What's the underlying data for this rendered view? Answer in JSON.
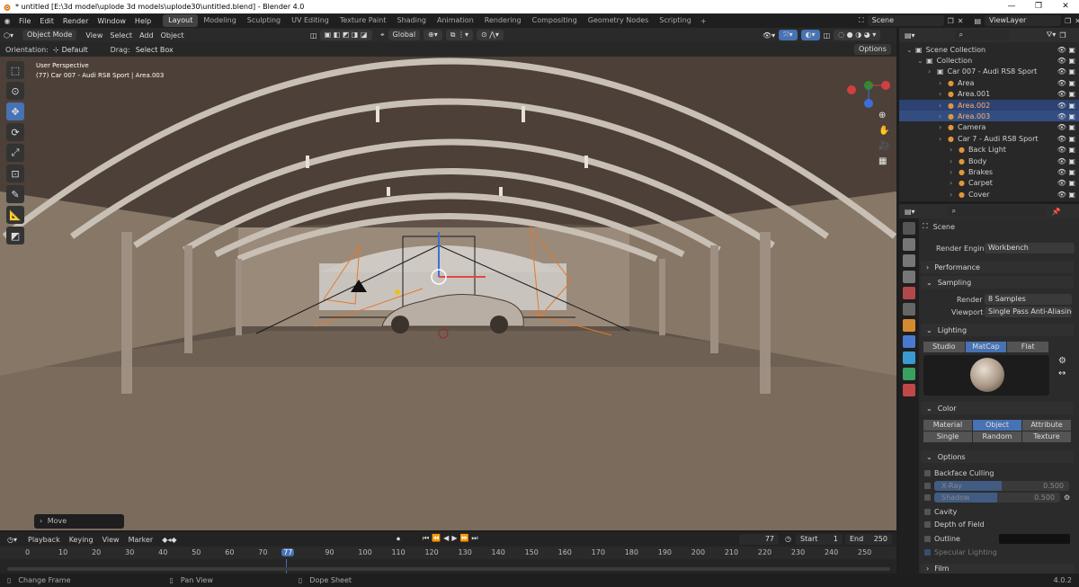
{
  "window": {
    "title": "* untitled [E:\\3d model\\uplode 3d models\\uplode30\\untitled.blend] - Blender 4.0"
  },
  "menus": [
    "File",
    "Edit",
    "Render",
    "Window",
    "Help"
  ],
  "workspaces": [
    "Layout",
    "Modeling",
    "Sculpting",
    "UV Editing",
    "Texture Paint",
    "Shading",
    "Animation",
    "Rendering",
    "Compositing",
    "Geometry Nodes",
    "Scripting"
  ],
  "scene_field": "Scene",
  "viewlayer_field": "ViewLayer",
  "viewport_header": {
    "mode": "Object Mode",
    "menus": [
      "View",
      "Select",
      "Add",
      "Object"
    ],
    "transform": "Global",
    "options": "Options"
  },
  "tool_header": {
    "orientation_label": "Orientation:",
    "orientation_value": "Default",
    "drag_label": "Drag:",
    "drag_value": "Select Box"
  },
  "viewport": {
    "perspective": "User Perspective",
    "object_info": "(77) Car 007 - Audi RS8 Sport | Area.003",
    "last_op": "Move"
  },
  "timeline": {
    "menus": [
      "Playback",
      "Keying",
      "View",
      "Marker"
    ],
    "current_frame": "77",
    "start_label": "Start",
    "start": "1",
    "end_label": "End",
    "end": "250",
    "ticks": [
      "0",
      "10",
      "20",
      "30",
      "40",
      "50",
      "60",
      "70",
      "77",
      "90",
      "100",
      "110",
      "120",
      "130",
      "140",
      "150",
      "160",
      "170",
      "180",
      "190",
      "200",
      "210",
      "220",
      "230",
      "240",
      "250"
    ]
  },
  "statusbar": {
    "items": [
      "Change Frame",
      "Pan View",
      "Dope Sheet"
    ],
    "version": "4.0.2"
  },
  "outliner": {
    "rows": [
      {
        "label": "Scene Collection",
        "indent": 0,
        "sel": ""
      },
      {
        "label": "Collection",
        "indent": 1,
        "sel": ""
      },
      {
        "label": "Car 007 - Audi RS8 Sport",
        "indent": 2,
        "sel": ""
      },
      {
        "label": "Area",
        "indent": 3,
        "sel": ""
      },
      {
        "label": "Area.001",
        "indent": 3,
        "sel": ""
      },
      {
        "label": "Area.002",
        "indent": 3,
        "sel": "sel2"
      },
      {
        "label": "Area.003",
        "indent": 3,
        "sel": "sel"
      },
      {
        "label": "Camera",
        "indent": 3,
        "sel": ""
      },
      {
        "label": "Car 7 - Audi RS8 Sport",
        "indent": 3,
        "sel": ""
      },
      {
        "label": "Back Light",
        "indent": 4,
        "sel": ""
      },
      {
        "label": "Body",
        "indent": 4,
        "sel": ""
      },
      {
        "label": "Brakes",
        "indent": 4,
        "sel": ""
      },
      {
        "label": "Carpet",
        "indent": 4,
        "sel": ""
      },
      {
        "label": "Cover",
        "indent": 4,
        "sel": ""
      }
    ]
  },
  "properties": {
    "context": "Scene",
    "render_engine_label": "Render Engine",
    "render_engine": "Workbench",
    "performance": "Performance",
    "sampling": "Sampling",
    "render_label": "Render",
    "render_samples": "8 Samples",
    "viewport_label": "Viewport",
    "viewport_aa": "Single Pass Anti-Aliasing",
    "lighting": "Lighting",
    "lighting_modes": [
      "Studio",
      "MatCap",
      "Flat"
    ],
    "color": "Color",
    "color_modes_row1": [
      "Material",
      "Object",
      "Attribute"
    ],
    "color_modes_row2": [
      "Single",
      "Random",
      "Texture"
    ],
    "options": "Options",
    "backface": "Backface Culling",
    "xray": "X-Ray",
    "xray_val": "0.500",
    "shadow": "Shadow",
    "shadow_val": "0.500",
    "cavity": "Cavity",
    "dof": "Depth of Field",
    "outline": "Outline",
    "specular": "Specular Lighting",
    "film": "Film"
  }
}
